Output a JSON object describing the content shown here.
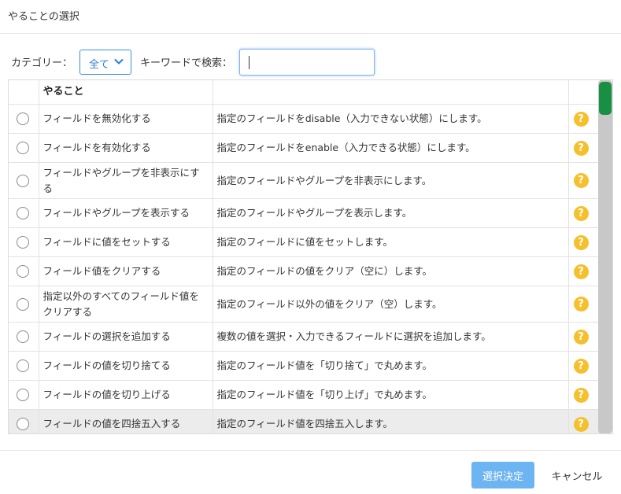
{
  "dialog": {
    "title": "やることの選択"
  },
  "filters": {
    "category_label": "カテゴリー：",
    "category_value": "全て",
    "keyword_label": "キーワードで検索：",
    "keyword_value": ""
  },
  "table": {
    "column_header": "やること",
    "rows": [
      {
        "action": "フィールドを無効化する",
        "description": "指定のフィールドをdisable（入力できない状態）にします。"
      },
      {
        "action": "フィールドを有効化する",
        "description": "指定のフィールドをenable（入力できる状態）にします。"
      },
      {
        "action": "フィールドやグループを非表示にする",
        "description": "指定のフィールドやグループを非表示にします。"
      },
      {
        "action": "フィールドやグループを表示する",
        "description": "指定のフィールドやグループを表示します。"
      },
      {
        "action": "フィールドに値をセットする",
        "description": "指定のフィールドに値をセットします。"
      },
      {
        "action": "フィールド値をクリアする",
        "description": "指定のフィールドの値をクリア（空に）します。"
      },
      {
        "action": "指定以外のすべてのフィールド値をクリアする",
        "description": "指定のフィールド以外の値をクリア（空）します。"
      },
      {
        "action": "フィールドの選択を追加する",
        "description": "複数の値を選択・入力できるフィールドに選択を追加します。"
      },
      {
        "action": "フィールドの値を切り捨てる",
        "description": "指定のフィールド値を「切り捨て」で丸めます。"
      },
      {
        "action": "フィールドの値を切り上げる",
        "description": "指定のフィールド値を「切り上げ」で丸めます。"
      },
      {
        "action": "フィールドの値を四捨五入する",
        "description": "指定のフィールド値を四捨五入します。"
      }
    ],
    "help_glyph": "?"
  },
  "footer": {
    "confirm_label": "選択決定",
    "cancel_label": "キャンセル"
  },
  "colors": {
    "accent_blue": "#3a8ee6",
    "primary_button": "#6cb4f2",
    "help_icon": "#f5c02c",
    "scroll_thumb": "#189044"
  },
  "icons": {
    "category_chevron": "chevron-down-icon",
    "row_help": "help-icon",
    "row_select": "radio-button"
  }
}
